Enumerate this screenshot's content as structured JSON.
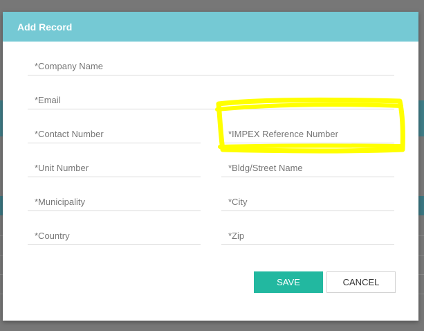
{
  "dialog": {
    "title": "Add Record",
    "fields": {
      "company_name": {
        "placeholder": "*Company Name",
        "value": ""
      },
      "email": {
        "placeholder": "*Email",
        "value": ""
      },
      "contact_number": {
        "placeholder": "*Contact Number",
        "value": ""
      },
      "impex_reference_number": {
        "placeholder": "*IMPEX Reference Number",
        "value": ""
      },
      "unit_number": {
        "placeholder": "*Unit Number",
        "value": ""
      },
      "bldg_street_name": {
        "placeholder": "*Bldg/Street Name",
        "value": ""
      },
      "municipality": {
        "placeholder": "*Municipality",
        "value": ""
      },
      "city": {
        "placeholder": "*City",
        "value": ""
      },
      "country": {
        "placeholder": "*Country",
        "value": ""
      },
      "zip": {
        "placeholder": "*Zip",
        "value": ""
      }
    },
    "buttons": {
      "save_label": "SAVE",
      "cancel_label": "CANCEL"
    }
  },
  "annotation": {
    "highlight_color": "#ffff00"
  },
  "colors": {
    "header": "#75c9d4",
    "save_button": "#22b8a0"
  }
}
